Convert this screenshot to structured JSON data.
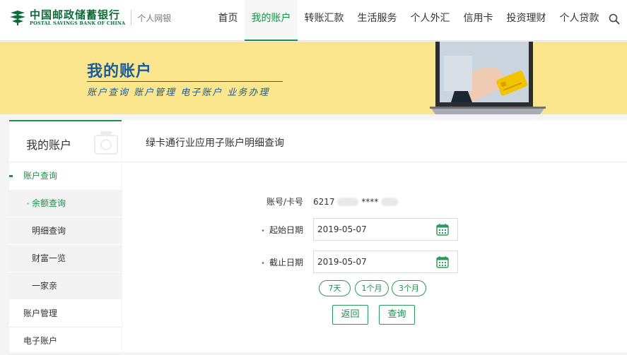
{
  "brand": {
    "name_cn": "中国邮政储蓄银行",
    "name_en": "POSTAL SAVINGS BANK OF CHINA",
    "sub": "个人网银",
    "color": "#17914b"
  },
  "nav": {
    "items": [
      {
        "label": "首页",
        "active": false
      },
      {
        "label": "我的账户",
        "active": true
      },
      {
        "label": "转账汇款",
        "active": false
      },
      {
        "label": "生活服务",
        "active": false
      },
      {
        "label": "个人外汇",
        "active": false
      },
      {
        "label": "信用卡",
        "active": false
      },
      {
        "label": "投资理财",
        "active": false
      },
      {
        "label": "个人贷款",
        "active": false
      }
    ],
    "search_icon": "search-icon"
  },
  "banner": {
    "title": "我的账户",
    "subtitle": "账户查询 账户管理 电子账户 业务办理"
  },
  "sidebar": {
    "title": "我的账户",
    "groups": [
      {
        "label": "账户查询"
      },
      {
        "label": "账户管理"
      },
      {
        "label": "电子账户"
      }
    ],
    "sub_items": [
      {
        "label": "余额查询"
      },
      {
        "label": "明细查询"
      },
      {
        "label": "财富一览"
      },
      {
        "label": "一家亲"
      }
    ]
  },
  "main": {
    "title": "绿卡通行业应用子账户明细查询",
    "account": {
      "label": "账号/卡号",
      "prefix": "6217",
      "middle": "****"
    },
    "start_date": {
      "label": "起始日期",
      "value": "2019-05-07"
    },
    "end_date": {
      "label": "截止日期",
      "value": "2019-05-07"
    },
    "quick_ranges": [
      "7天",
      "1个月",
      "3个月"
    ],
    "buttons": {
      "back": "返回",
      "query": "查询"
    }
  }
}
